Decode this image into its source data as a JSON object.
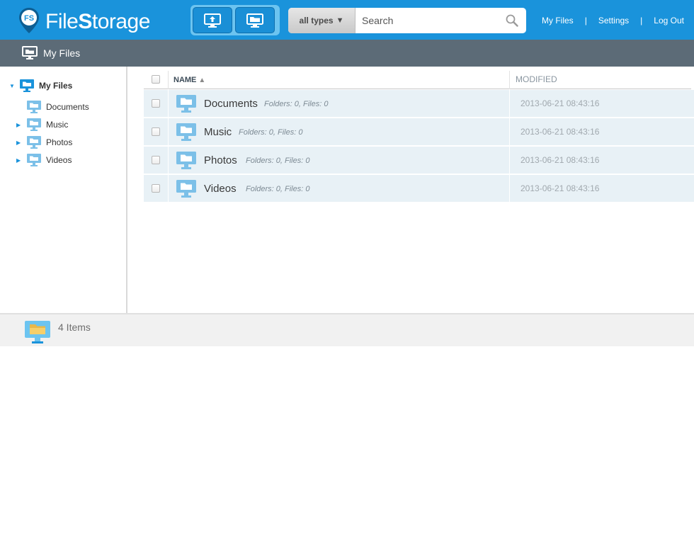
{
  "app": {
    "logo_text_a": "File",
    "logo_text_b": "S",
    "logo_text_c": "torage",
    "logo_mark": "FS"
  },
  "view_switch": {
    "upload_icon": "upload-monitor-icon",
    "files_icon": "files-monitor-icon"
  },
  "search": {
    "type_label": "all types",
    "placeholder": "Search",
    "value": ""
  },
  "nav": {
    "my_files": "My Files",
    "settings": "Settings",
    "log_out": "Log Out",
    "separator": "|"
  },
  "subbar": {
    "title": "My Files"
  },
  "sidebar": {
    "root": {
      "label": "My Files",
      "expanded": true
    },
    "items": [
      {
        "label": "Documents",
        "has_children": false
      },
      {
        "label": "Music",
        "has_children": true
      },
      {
        "label": "Photos",
        "has_children": true
      },
      {
        "label": "Videos",
        "has_children": true
      }
    ]
  },
  "list": {
    "col_name": "NAME",
    "col_modified": "MODIFIED",
    "sort_indicator": "▲",
    "rows": [
      {
        "name": "Documents",
        "meta": "Folders: 0, Files: 0",
        "modified": "2013-06-21 08:43:16"
      },
      {
        "name": "Music",
        "meta": "Folders: 0, Files: 0",
        "modified": "2013-06-21 08:43:16"
      },
      {
        "name": "Photos",
        "meta": "Folders: 0, Files: 0",
        "modified": "2013-06-21 08:43:16"
      },
      {
        "name": "Videos",
        "meta": "Folders: 0, Files: 0",
        "modified": "2013-06-21 08:43:16"
      }
    ]
  },
  "status": {
    "count_text": "4 Items"
  },
  "colors": {
    "brand_blue": "#1a93db",
    "subbar_gray": "#5c6b77",
    "row_bg": "#e8f1f6"
  }
}
